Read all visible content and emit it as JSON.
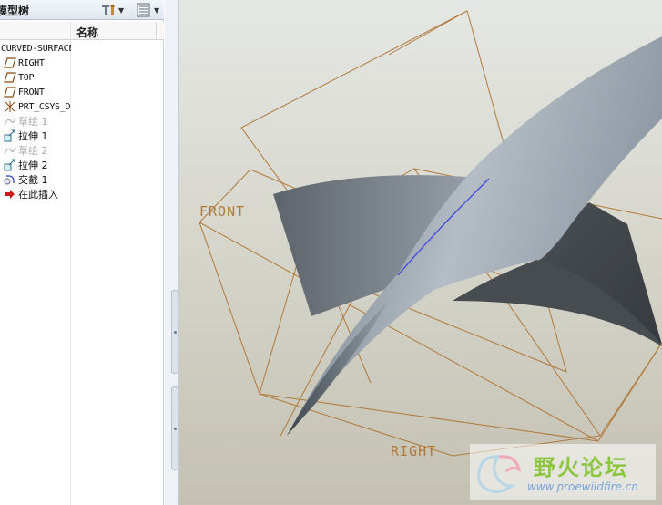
{
  "model_tree": {
    "title": "模型树",
    "column_name": "名称",
    "root_label": "CURVED-SURFACE.PRT",
    "items": [
      {
        "label": "RIGHT",
        "icon": "datum-plane-icon",
        "dimmed": false
      },
      {
        "label": "TOP",
        "icon": "datum-plane-icon",
        "dimmed": false
      },
      {
        "label": "FRONT",
        "icon": "datum-plane-icon",
        "dimmed": false
      },
      {
        "label": "PRT_CSYS_DEF",
        "icon": "coordinate-system-icon",
        "dimmed": false
      },
      {
        "label": "草绘 1",
        "icon": "sketch-icon",
        "dimmed": true
      },
      {
        "label": "拉伸 1",
        "icon": "extrude-icon",
        "dimmed": false
      },
      {
        "label": "草绘 2",
        "icon": "sketch-icon",
        "dimmed": true
      },
      {
        "label": "拉伸 2",
        "icon": "extrude-icon",
        "dimmed": false
      },
      {
        "label": "交截 1",
        "icon": "intersect-icon",
        "dimmed": false
      },
      {
        "label": "在此插入",
        "icon": "insert-here-arrow-icon",
        "dimmed": false
      }
    ]
  },
  "toolbar": {
    "settings_icon": "tree-settings-icon",
    "columns_icon": "tree-columns-icon"
  },
  "viewport": {
    "datum_labels": {
      "front": "FRONT",
      "right": "RIGHT"
    },
    "colors": {
      "datum": "#b07a3c",
      "surface_light": "#aab4be",
      "surface_dark": "#3f4448",
      "intersection_curve": "#3f48d9"
    }
  },
  "watermark": {
    "title": "野火论坛",
    "url": "www.proewildfire.cn"
  }
}
